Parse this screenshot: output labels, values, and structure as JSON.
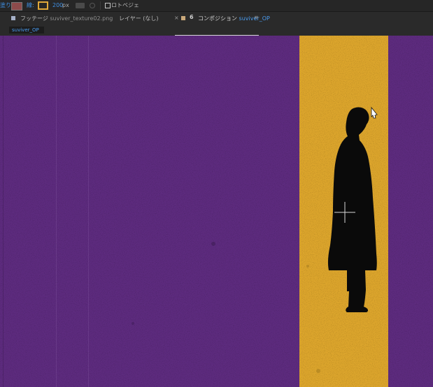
{
  "toolbar": {
    "fill_label": "塗り:",
    "stroke_label": "線:",
    "stroke_width": "200",
    "stroke_unit": "px",
    "rotobezier_label": "ロトベジェ"
  },
  "tabs": {
    "footage_prefix": "フッテージ",
    "footage_name": "suviver_texture02.png",
    "layer_label": "レイヤー (なし)",
    "close_glyph": "×",
    "lock_glyph": "6",
    "comp_prefix": "コンポジション",
    "comp_name": "suviver_OP",
    "menu_glyph": "≡",
    "comp_subtab": "suviver_OP"
  },
  "colors": {
    "background_purple": "#5d2b7e",
    "stripe_yellow": "#dca52c",
    "silhouette": "#0a0a0a",
    "stroke_swatch": "#e0a93a",
    "fill_swatch": "#8d4b4b",
    "ui_blue": "#3f8fe3"
  },
  "icons": {
    "fill": "fill-swatch-icon",
    "stroke": "stroke-swatch-icon",
    "footage": "footage-icon",
    "comp": "composition-icon",
    "lock": "lock-icon",
    "menu": "panel-menu-icon",
    "pen": "pen-cursor-icon",
    "crosshair": "anchor-crosshair-icon"
  }
}
